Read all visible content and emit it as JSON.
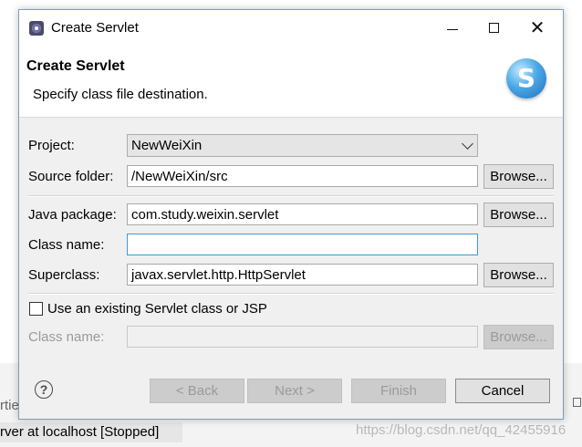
{
  "background": {
    "partial_label": "rtie",
    "server_status": "rver at localhost  [Stopped]",
    "watermark": "https://blog.csdn.net/qq_42455916"
  },
  "dialog": {
    "window_title": "Create Servlet",
    "controls": {
      "minimize": "minimize-icon",
      "maximize": "maximize-icon",
      "close": "✕"
    },
    "header": {
      "title": "Create Servlet",
      "description": "Specify class file destination.",
      "logo_letter": "S"
    },
    "project": {
      "label": "Project:",
      "value": "NewWeiXin"
    },
    "source_folder": {
      "label": "Source folder:",
      "value": "/NewWeiXin/src",
      "browse": "Browse..."
    },
    "java_package": {
      "label": "Java package:",
      "value": "com.study.weixin.servlet",
      "browse": "Browse..."
    },
    "class_name": {
      "label": "Class name:",
      "value": ""
    },
    "superclass": {
      "label": "Superclass:",
      "value": "javax.servlet.http.HttpServlet",
      "browse": "Browse..."
    },
    "use_existing": {
      "label": "Use an existing Servlet class or JSP",
      "checked": false
    },
    "existing_class_name": {
      "label": "Class name:",
      "value": "",
      "browse": "Browse..."
    },
    "footer": {
      "help": "?",
      "back": "< Back",
      "next": "Next >",
      "finish": "Finish",
      "cancel": "Cancel"
    }
  },
  "colors": {
    "dialog_bg": "#f0f0f0",
    "focus_border": "#3c9bd6",
    "disabled_text": "#9a9a9a"
  }
}
